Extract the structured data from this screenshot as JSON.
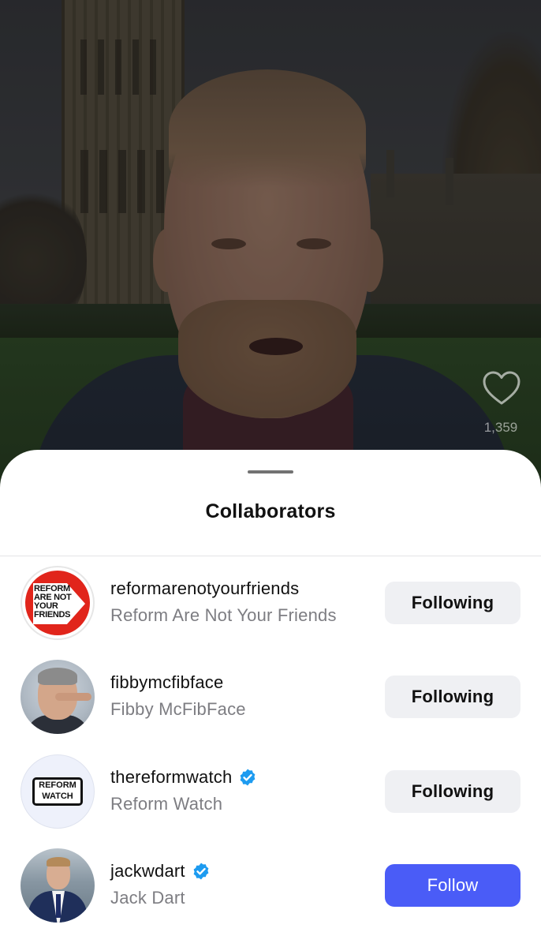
{
  "video": {
    "like_count": "1,359",
    "like_icon": "heart-outline-icon"
  },
  "sheet": {
    "title": "Collaborators",
    "collaborators": [
      {
        "handle": "reformarenotyourfriends",
        "display_name": "Reform Are Not Your Friends",
        "verified": false,
        "button_label": "Following",
        "button_state": "following",
        "avatar_text": "REFORM ARE NOT YOUR FRIENDS"
      },
      {
        "handle": "fibbymcfibface",
        "display_name": "Fibby McFibFace",
        "verified": false,
        "button_label": "Following",
        "button_state": "following"
      },
      {
        "handle": "thereformwatch",
        "display_name": "Reform Watch",
        "verified": true,
        "button_label": "Following",
        "button_state": "following",
        "avatar_text": "REFORM WATCH"
      },
      {
        "handle": "jackwdart",
        "display_name": "Jack Dart",
        "verified": true,
        "button_label": "Follow",
        "button_state": "follow"
      }
    ]
  },
  "colors": {
    "follow_button": "#4a5cf7",
    "following_button": "#eff0f3",
    "verified_badge": "#1d9bf0",
    "reform_red": "#e1251b"
  }
}
